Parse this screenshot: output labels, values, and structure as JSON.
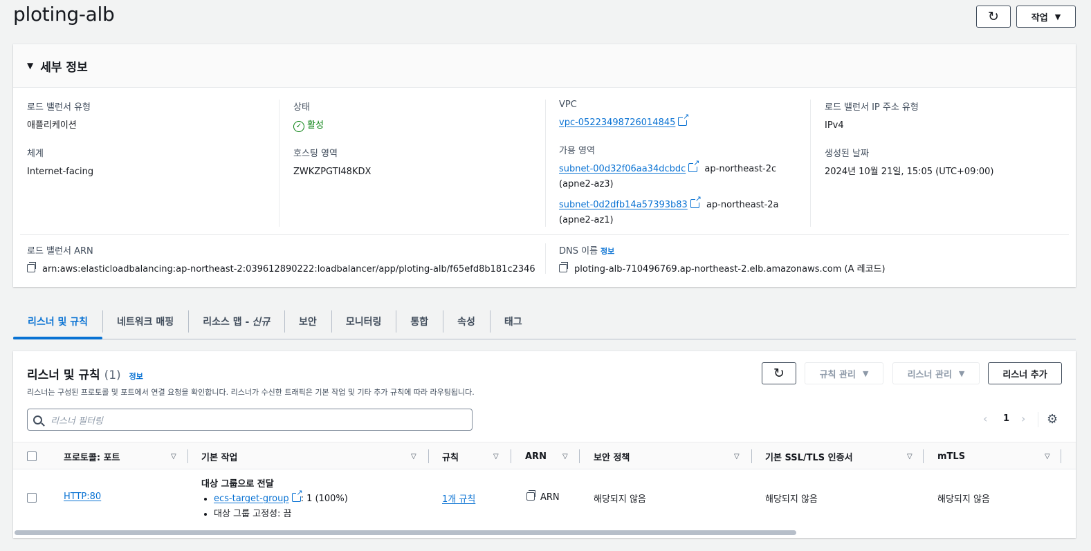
{
  "page": {
    "title": "ploting-alb"
  },
  "header_actions": {
    "refresh_icon": "refresh-icon",
    "actions_label": "작업"
  },
  "details": {
    "section_title": "세부 정보",
    "lb_type": {
      "label": "로드 밸런서 유형",
      "value": "애플리케이션"
    },
    "scheme": {
      "label": "체계",
      "value": "Internet-facing"
    },
    "state": {
      "label": "상태",
      "value": "활성"
    },
    "hosted_zone": {
      "label": "호스팅 영역",
      "value": "ZWKZPGTI48KDX"
    },
    "vpc": {
      "label": "VPC",
      "value": "vpc-05223498726014845"
    },
    "azs": {
      "label": "가용 영역",
      "items": [
        {
          "subnet": "subnet-00d32f06aa34dcbdc",
          "zone": "ap-northeast-2c",
          "az_id": "(apne2-az3)"
        },
        {
          "subnet": "subnet-0d2dfb14a57393b83",
          "zone": "ap-northeast-2a",
          "az_id": "(apne2-az1)"
        }
      ]
    },
    "ip_type": {
      "label": "로드 밸런서 IP 주소 유형",
      "value": "IPv4"
    },
    "created": {
      "label": "생성된 날짜",
      "value": "2024년 10월 21일, 15:05 (UTC+09:00)"
    },
    "arn": {
      "label": "로드 밸런서 ARN",
      "value": "arn:aws:elasticloadbalancing:ap-northeast-2:039612890222:loadbalancer/app/ploting-alb/f65efd8b181c2346"
    },
    "dns": {
      "label": "DNS 이름",
      "info": "정보",
      "value": "ploting-alb-710496769.ap-northeast-2.elb.amazonaws.com (A 레코드)"
    }
  },
  "tabs": [
    {
      "label": "리스너 및 규칙",
      "active": true
    },
    {
      "label": "네트워크 매핑"
    },
    {
      "label": "리소스 맵 -",
      "suffix": "신규"
    },
    {
      "label": "보안"
    },
    {
      "label": "모니터링"
    },
    {
      "label": "통합"
    },
    {
      "label": "속성"
    },
    {
      "label": "태그"
    }
  ],
  "listeners": {
    "title": "리스너 및 규칙",
    "count": "(1)",
    "info": "정보",
    "description": "리스너는 구성된 프로토콜 및 포트에서 연결 요청을 확인합니다. 리스너가 수신한 트래픽은 기본 작업 및 기타 추가 규칙에 따라 라우팅됩니다.",
    "manage_rules": "규칙 관리",
    "manage_listener": "리스너 관리",
    "add_listener": "리스너 추가",
    "filter_placeholder": "리스너 필터링",
    "page": "1",
    "columns": [
      "프로토콜: 포트",
      "기본 작업",
      "규칙",
      "ARN",
      "보안 정책",
      "기본 SSL/TLS 인증서",
      "mTLS"
    ],
    "rows": [
      {
        "protocol_port": "HTTP:80",
        "action_title": "대상 그룹으로 전달",
        "target_group": "ecs-target-group",
        "target_weight": ": 1 (100%)",
        "stickiness": "대상 그룹 고정성: 끔",
        "rules": "1개 규칙",
        "arn": "ARN",
        "security_policy": "해당되지 않음",
        "ssl_cert": "해당되지 않음",
        "mtls": "해당되지 않음"
      }
    ]
  }
}
